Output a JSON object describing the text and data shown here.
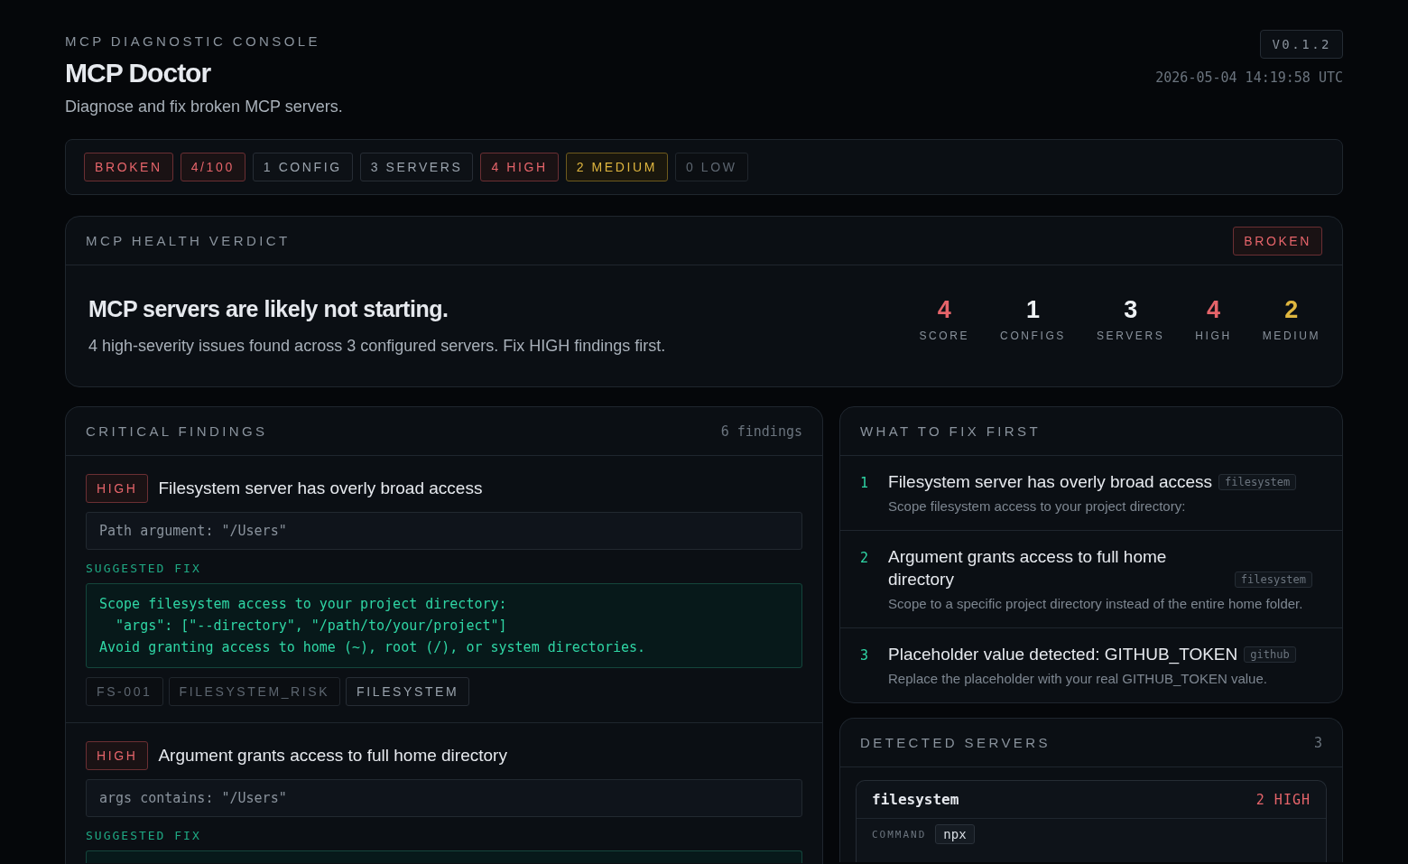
{
  "header": {
    "eyebrow": "MCP DIAGNOSTIC CONSOLE",
    "title": "MCP Doctor",
    "subtitle": "Diagnose and fix broken MCP servers.",
    "version": "V0.1.2",
    "timestamp": "2026-05-04 14:19:58 UTC"
  },
  "summary_chips": [
    {
      "label": "BROKEN",
      "kind": "high"
    },
    {
      "label": "4/100",
      "kind": "high"
    },
    {
      "label": "1 CONFIG",
      "kind": "neutral"
    },
    {
      "label": "3 SERVERS",
      "kind": "neutral"
    },
    {
      "label": "4 HIGH",
      "kind": "high"
    },
    {
      "label": "2 MEDIUM",
      "kind": "medium"
    },
    {
      "label": "0 LOW",
      "kind": "muted"
    }
  ],
  "verdict": {
    "heading": "MCP HEALTH VERDICT",
    "badge": {
      "label": "BROKEN",
      "kind": "high"
    },
    "title": "MCP servers are likely not starting.",
    "description": "4 high-severity issues found across 3 configured servers. Fix HIGH findings first.",
    "stats": [
      {
        "value": "4",
        "label": "SCORE",
        "kind": "high"
      },
      {
        "value": "1",
        "label": "CONFIGS",
        "kind": "neutral"
      },
      {
        "value": "3",
        "label": "SERVERS",
        "kind": "neutral"
      },
      {
        "value": "4",
        "label": "HIGH",
        "kind": "high"
      },
      {
        "value": "2",
        "label": "MEDIUM",
        "kind": "medium"
      }
    ]
  },
  "findings": {
    "heading": "CRITICAL FINDINGS",
    "count": "6 findings",
    "items": [
      {
        "severity": {
          "label": "HIGH",
          "kind": "high"
        },
        "title": "Filesystem server has overly broad access",
        "evidence": "Path argument: \"/Users\"",
        "fix_label": "SUGGESTED FIX",
        "fix": [
          "Scope filesystem access to your project directory:",
          "  \"args\": [\"--directory\", \"/path/to/your/project\"]",
          "Avoid granting access to home (~), root (/), or system directories."
        ],
        "tags": [
          {
            "label": "FS-001",
            "kind": "muted"
          },
          {
            "label": "FILESYSTEM_RISK",
            "kind": "muted"
          },
          {
            "label": "FILESYSTEM",
            "kind": "neutral"
          }
        ]
      },
      {
        "severity": {
          "label": "HIGH",
          "kind": "high"
        },
        "title": "Argument grants access to full home directory",
        "evidence": "args contains: \"/Users\"",
        "fix_label": "SUGGESTED FIX"
      }
    ]
  },
  "fix_first": {
    "heading": "WHAT TO FIX FIRST",
    "items": [
      {
        "number": "1",
        "title": "Filesystem server has overly broad access",
        "server": "filesystem",
        "description": "Scope filesystem access to your project directory:"
      },
      {
        "number": "2",
        "title": "Argument grants access to full home directory",
        "server": "filesystem",
        "description": "Scope to a specific project directory instead of the entire home folder."
      },
      {
        "number": "3",
        "title": "Placeholder value detected: GITHUB_TOKEN",
        "server": "github",
        "description": "Replace the placeholder with your real GITHUB_TOKEN value."
      }
    ]
  },
  "servers": {
    "heading": "DETECTED SERVERS",
    "count": "3",
    "items": [
      {
        "name": "filesystem",
        "status": {
          "label": "2 HIGH",
          "kind": "high"
        },
        "fields": [
          {
            "label": "COMMAND",
            "value": "npx"
          }
        ]
      }
    ]
  }
}
